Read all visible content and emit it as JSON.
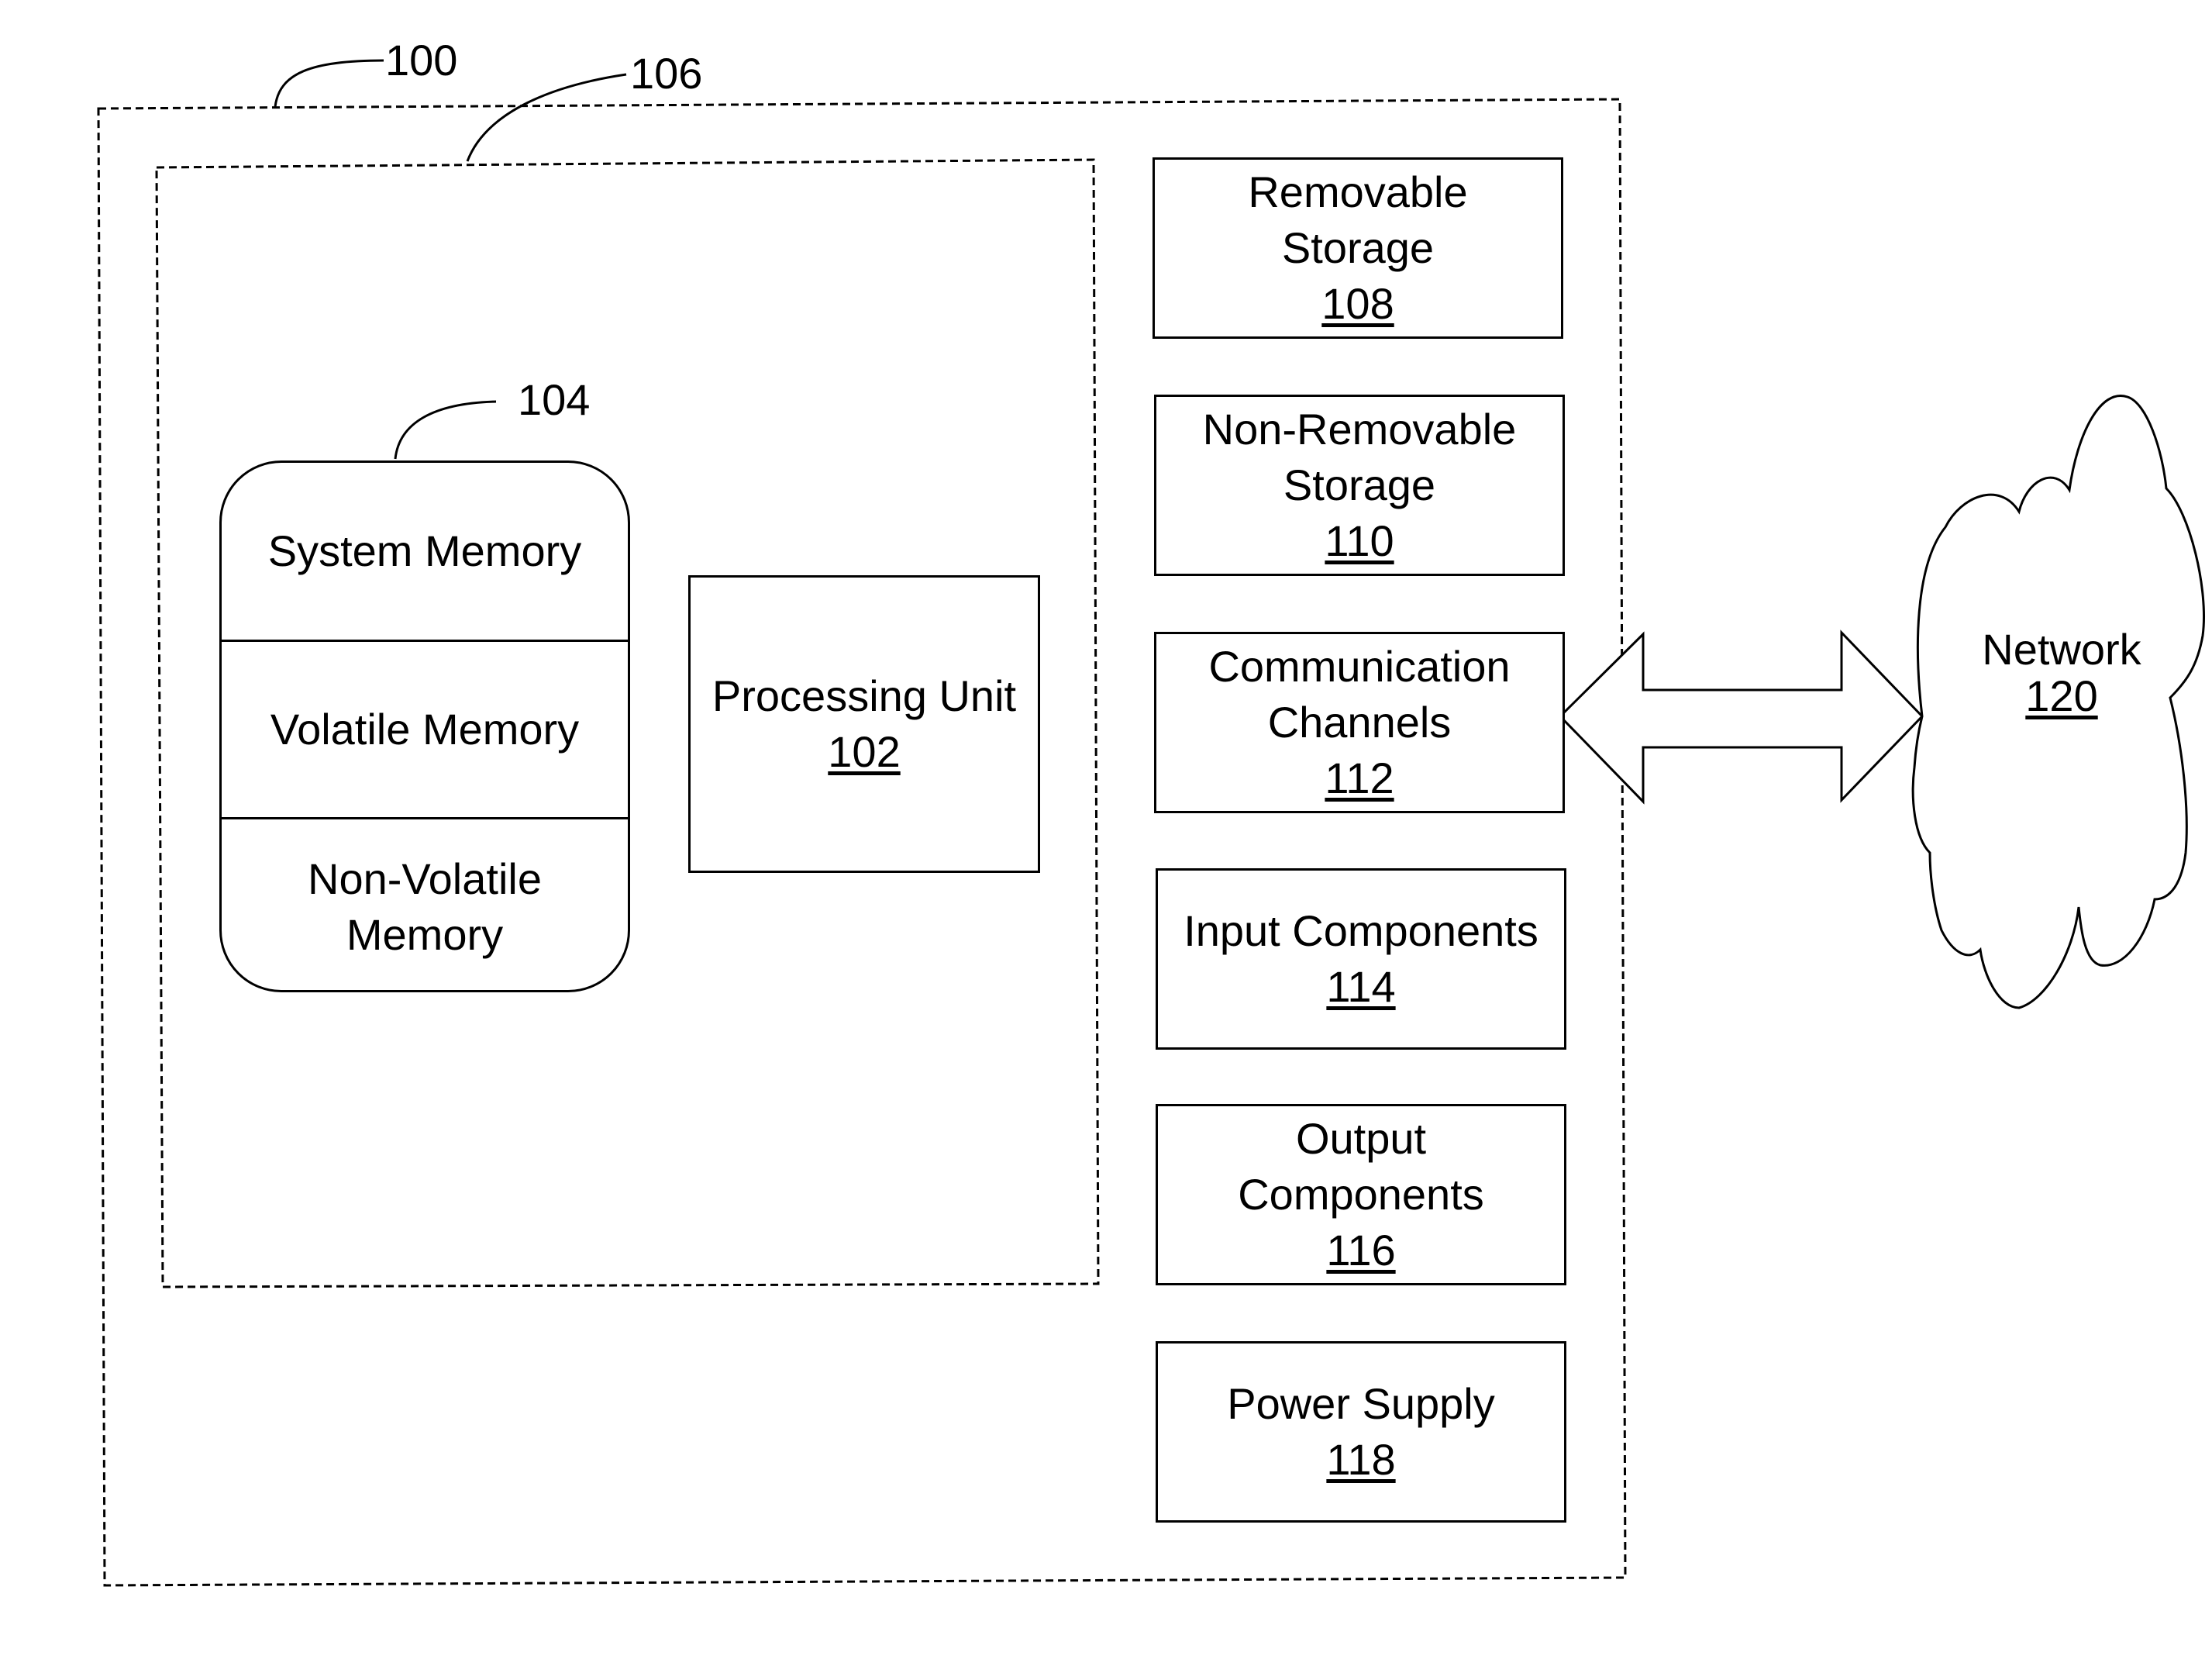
{
  "diagram": {
    "refs": {
      "device": "100",
      "processing_area": "106",
      "memory_group": "104"
    },
    "memory": {
      "sections": [
        {
          "label": "System Memory"
        },
        {
          "label": "Volatile Memory"
        },
        {
          "label": "Non-Volatile Memory"
        }
      ]
    },
    "processing_unit": {
      "label": "Processing Unit",
      "number": "102"
    },
    "components": [
      {
        "label": "Removable Storage",
        "number": "108"
      },
      {
        "label": "Non-Removable Storage",
        "number": "110"
      },
      {
        "label": "Communication Channels",
        "number": "112"
      },
      {
        "label": "Input Components",
        "number": "114"
      },
      {
        "label": "Output Components",
        "number": "116"
      },
      {
        "label": "Power Supply",
        "number": "118"
      }
    ],
    "network": {
      "label": "Network",
      "number": "120"
    },
    "colors": {
      "line": "#000000",
      "background": "#ffffff"
    }
  }
}
